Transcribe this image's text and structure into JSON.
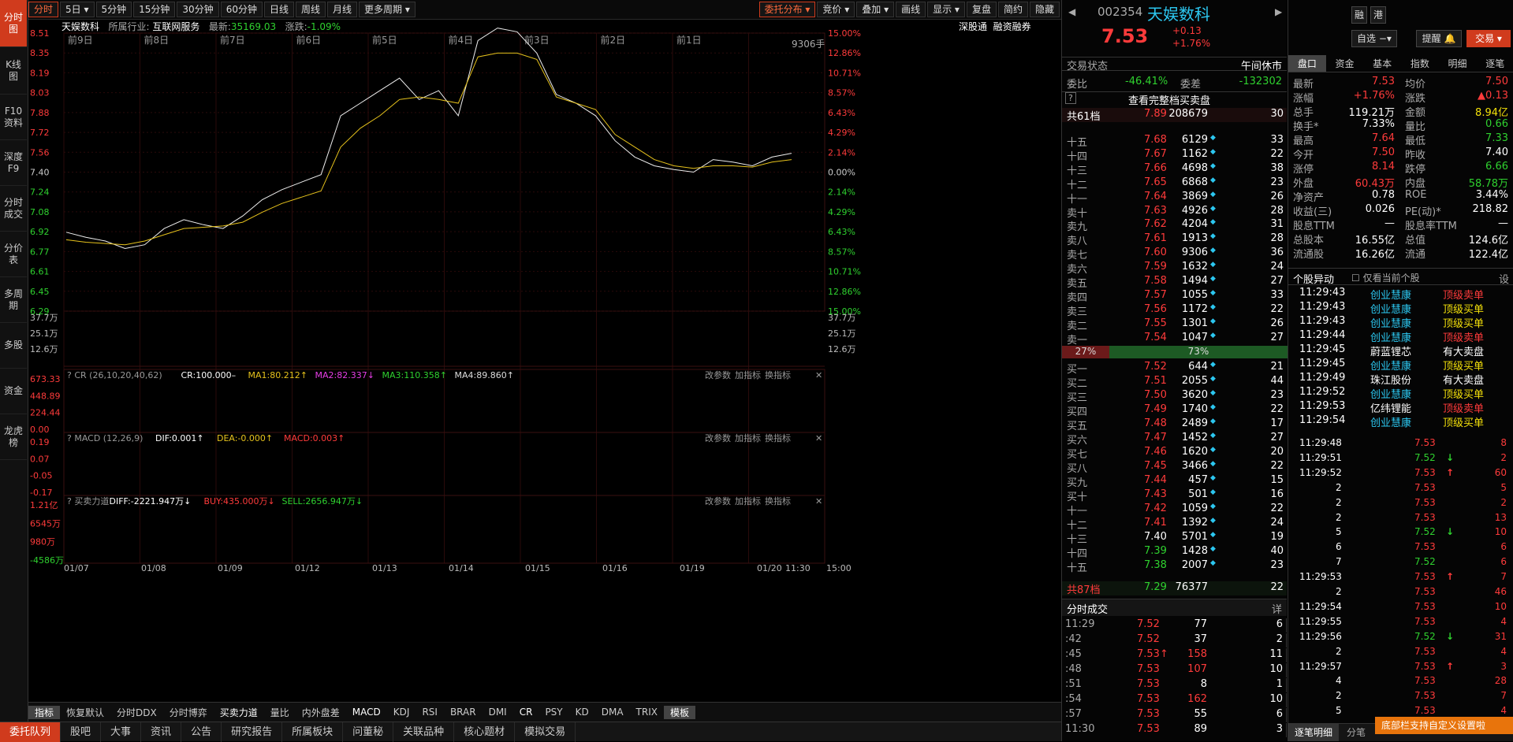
{
  "left_nav": [
    "分时图",
    "K线图",
    "F10资料",
    "深度F9",
    "分时成交",
    "分价表",
    "多周期",
    "多股",
    "资金",
    "龙虎榜"
  ],
  "toolbar": {
    "periods": [
      "分时",
      "5日",
      "5分钟",
      "15分钟",
      "30分钟",
      "60分钟",
      "日线",
      "周线",
      "月线",
      "更多周期"
    ],
    "tools": [
      "委托分布",
      "竞价",
      "叠加",
      "画线",
      "显示",
      "复盘",
      "简约",
      "隐藏"
    ]
  },
  "chart_info": {
    "name": "天娱数科",
    "industry_label": "所属行业:",
    "industry": "互联网服务",
    "latest_label": "最新:",
    "latest": "35169.03",
    "change_label": "涨跌:",
    "change": "-1.09%",
    "link1": "深股通",
    "link2": "融资融券",
    "volume_label": "9306手"
  },
  "chart_data": {
    "type": "line",
    "title": "天娱数科",
    "day_labels": [
      "前9日",
      "前8日",
      "前7日",
      "前6日",
      "前5日",
      "前4日",
      "前3日",
      "前2日",
      "前1日"
    ],
    "y_left": [
      "8.51",
      "8.35",
      "8.19",
      "8.03",
      "7.88",
      "7.72",
      "7.56",
      "7.40",
      "7.24",
      "7.08",
      "6.92",
      "6.77",
      "6.61",
      "6.45",
      "6.29"
    ],
    "y_right": [
      "15.00%",
      "12.86%",
      "10.71%",
      "8.57%",
      "6.43%",
      "4.29%",
      "2.14%",
      "0.00%",
      "2.14%",
      "4.29%",
      "6.43%",
      "8.57%",
      "10.71%",
      "12.86%",
      "15.00%"
    ],
    "ylim": [
      6.29,
      8.51
    ],
    "preclose": 7.4,
    "x_labels": [
      "01/07",
      "01/08",
      "01/09",
      "01/12",
      "01/13",
      "01/14",
      "01/15",
      "01/16",
      "01/19",
      "01/20",
      "11:30",
      "15:00"
    ],
    "series": [
      {
        "name": "price",
        "values": [
          6.92,
          6.88,
          6.85,
          6.79,
          6.82,
          6.95,
          7.02,
          6.98,
          6.95,
          7.05,
          7.18,
          7.26,
          7.32,
          7.38,
          7.85,
          7.95,
          8.05,
          8.15,
          7.98,
          8.05,
          7.85,
          8.45,
          8.55,
          8.52,
          8.35,
          8.02,
          7.95,
          7.85,
          7.65,
          7.52,
          7.45,
          7.42,
          7.4,
          7.5,
          7.48,
          7.45,
          7.52,
          7.55
        ]
      },
      {
        "name": "avg",
        "values": [
          6.86,
          6.84,
          6.83,
          6.82,
          6.85,
          6.9,
          6.95,
          6.96,
          6.97,
          7.0,
          7.08,
          7.15,
          7.2,
          7.25,
          7.6,
          7.75,
          7.85,
          7.98,
          8.0,
          7.98,
          7.95,
          8.32,
          8.35,
          8.35,
          8.3,
          8.0,
          7.95,
          7.9,
          7.7,
          7.6,
          7.5,
          7.45,
          7.43,
          7.45,
          7.45,
          7.44,
          7.48,
          7.5
        ]
      }
    ],
    "volume_axis": [
      "37.7万",
      "25.1万",
      "12.6万"
    ],
    "indicators": [
      {
        "name": "CR",
        "params": "(26,10,20,40,62)",
        "values": [
          "CR:100.000–",
          "MA1:80.212↑",
          "MA2:82.337↓",
          "MA3:110.358↑",
          "MA4:89.860↑"
        ],
        "axis": [
          "673.33",
          "448.89",
          "224.44",
          "0.00"
        ]
      },
      {
        "name": "MACD",
        "params": "(12,26,9)",
        "values": [
          "DIF:0.001↑",
          "DEA:-0.000↑",
          "MACD:0.003↑"
        ],
        "axis": [
          "0.19",
          "0.07",
          "-0.05",
          "-0.17"
        ]
      },
      {
        "name": "买卖力道",
        "params": "",
        "values": [
          "DIFF:-2221.947万↓",
          "BUY:435.000万↓",
          "SELL:2656.947万↓"
        ],
        "axis": [
          "1.21亿",
          "6545万",
          "980万",
          "-4586万"
        ]
      }
    ],
    "indicator_actions": [
      "改参数",
      "加指标",
      "换指标"
    ]
  },
  "bottom_bar": [
    "指标",
    "恢复默认",
    "分时DDX",
    "分时博弈",
    "买卖力道",
    "量比",
    "内外盘差",
    "MACD",
    "KDJ",
    "RSI",
    "BRAR",
    "DMI",
    "CR",
    "PSY",
    "KD",
    "DMA",
    "TRIX",
    "模板"
  ],
  "bottom_tabs": [
    "委托队列",
    "股吧",
    "大事",
    "资讯",
    "公告",
    "研究报告",
    "所属板块",
    "问董秘",
    "关联品种",
    "核心题材",
    "模拟交易"
  ],
  "quote": {
    "code": "002354",
    "name": "天娱数科",
    "price": "7.53",
    "chg": "+0.13",
    "pct": "+1.76%",
    "status_label": "交易状态",
    "status": "午间休市",
    "wb_label": "委比",
    "wb": "-46.41%",
    "wc_label": "委差",
    "wc": "-132302",
    "full_link": "查看完整档买卖盘",
    "sell_total": {
      "label": "共61档",
      "price": "7.89",
      "vol": "208679",
      "n": "30"
    },
    "buy_total": {
      "label": "共87档",
      "price": "7.29",
      "vol": "76377",
      "n": "22"
    },
    "sells": [
      [
        "十五",
        "7.68",
        "6129",
        "33"
      ],
      [
        "十四",
        "7.67",
        "1162",
        "22"
      ],
      [
        "十三",
        "7.66",
        "4698",
        "38"
      ],
      [
        "十二",
        "7.65",
        "6868",
        "23"
      ],
      [
        "十一",
        "7.64",
        "3869",
        "26"
      ],
      [
        "卖十",
        "7.63",
        "4926",
        "28"
      ],
      [
        "卖九",
        "7.62",
        "4204",
        "31"
      ],
      [
        "卖八",
        "7.61",
        "1913",
        "28"
      ],
      [
        "卖七",
        "7.60",
        "9306",
        "36"
      ],
      [
        "卖六",
        "7.59",
        "1632",
        "24"
      ],
      [
        "卖五",
        "7.58",
        "1494",
        "27"
      ],
      [
        "卖四",
        "7.57",
        "1055",
        "33"
      ],
      [
        "卖三",
        "7.56",
        "1172",
        "22"
      ],
      [
        "卖二",
        "7.55",
        "1301",
        "26"
      ],
      [
        "卖一",
        "7.54",
        "1047",
        "27"
      ]
    ],
    "ratio": [
      "27%",
      "73%"
    ],
    "buys": [
      [
        "买一",
        "7.52",
        "644",
        "21"
      ],
      [
        "买二",
        "7.51",
        "2055",
        "44"
      ],
      [
        "买三",
        "7.50",
        "3620",
        "23"
      ],
      [
        "买四",
        "7.49",
        "1740",
        "22"
      ],
      [
        "买五",
        "7.48",
        "2489",
        "17"
      ],
      [
        "买六",
        "7.47",
        "1452",
        "27"
      ],
      [
        "买七",
        "7.46",
        "1620",
        "20"
      ],
      [
        "买八",
        "7.45",
        "3466",
        "22"
      ],
      [
        "买九",
        "7.44",
        "457",
        "15"
      ],
      [
        "买十",
        "7.43",
        "501",
        "16"
      ],
      [
        "十一",
        "7.42",
        "1059",
        "22"
      ],
      [
        "十二",
        "7.41",
        "1392",
        "24"
      ],
      [
        "十三",
        "7.40",
        "5701",
        "19"
      ],
      [
        "十四",
        "7.39",
        "1428",
        "40"
      ],
      [
        "十五",
        "7.38",
        "2007",
        "23"
      ]
    ],
    "ticks_title": "分时成交",
    "ticks_detail": "详",
    "ticks": [
      [
        "11:29",
        "7.52",
        "77",
        "6"
      ],
      [
        ":42",
        "7.52",
        "37",
        "2"
      ],
      [
        ":45",
        "7.53↑",
        "158",
        "11"
      ],
      [
        ":48",
        "7.53",
        "107",
        "10"
      ],
      [
        ":51",
        "7.53",
        "8",
        "1"
      ],
      [
        ":54",
        "7.53",
        "162",
        "10"
      ],
      [
        ":57",
        "7.53",
        "55",
        "6"
      ],
      [
        "11:30",
        "7.53",
        "89",
        "3"
      ]
    ]
  },
  "far_right": {
    "tags": [
      "融",
      "港"
    ],
    "buttons": [
      "自选",
      "提醒",
      "交易"
    ],
    "tabs": [
      "盘口",
      "资金",
      "基本",
      "指数",
      "明细",
      "逐笔"
    ],
    "stats": [
      [
        "最新",
        "7.53",
        "均价",
        "7.50"
      ],
      [
        "涨幅",
        "+1.76%",
        "涨跌",
        "▲0.13"
      ],
      [
        "总手",
        "119.21万",
        "金额",
        "8.94亿"
      ],
      [
        "换手*",
        "7.33%",
        "量比",
        "0.66"
      ],
      [
        "最高",
        "7.64",
        "最低",
        "7.33"
      ],
      [
        "今开",
        "7.50",
        "昨收",
        "7.40"
      ],
      [
        "涨停",
        "8.14",
        "跌停",
        "6.66"
      ],
      [
        "外盘",
        "60.43万",
        "内盘",
        "58.78万"
      ],
      [
        "净资产",
        "0.78",
        "ROE",
        "3.44%"
      ],
      [
        "收益(三)",
        "0.026",
        "PE(动)*",
        "218.82"
      ],
      [
        "股息TTM",
        "—",
        "股息率TTM",
        "—"
      ],
      [
        "总股本",
        "16.55亿",
        "总值",
        "124.6亿"
      ],
      [
        "流通股",
        "16.26亿",
        "流通",
        "122.4亿"
      ]
    ],
    "movers_title": "个股异动",
    "movers_opt": "仅看当前个股",
    "movers_set": "设",
    "movers": [
      [
        "11:29:43",
        "创业慧康",
        "顶级卖单"
      ],
      [
        "11:29:43",
        "创业慧康",
        "顶级买单"
      ],
      [
        "11:29:43",
        "创业慧康",
        "顶级买单"
      ],
      [
        "11:29:44",
        "创业慧康",
        "顶级卖单"
      ],
      [
        "11:29:45",
        "蔚蓝锂芯",
        "有大卖盘"
      ],
      [
        "11:29:45",
        "创业慧康",
        "顶级买单"
      ],
      [
        "11:29:49",
        "珠江股份",
        "有大卖盘"
      ],
      [
        "11:29:52",
        "创业慧康",
        "顶级买单"
      ],
      [
        "11:29:53",
        "亿纬锂能",
        "顶级卖单"
      ],
      [
        "11:29:54",
        "创业慧康",
        "顶级买单"
      ]
    ],
    "trades": [
      [
        "11:29:48",
        "7.53",
        "",
        "8"
      ],
      [
        "11:29:51",
        "7.52",
        "↓",
        "2"
      ],
      [
        "11:29:52",
        "7.53",
        "↑",
        "60"
      ],
      [
        "2",
        "7.53",
        "",
        "5"
      ],
      [
        "2",
        "7.53",
        "",
        "2"
      ],
      [
        "2",
        "7.53",
        "",
        "13"
      ],
      [
        "5",
        "7.52",
        "↓",
        "10"
      ],
      [
        "6",
        "7.53",
        "",
        "6"
      ],
      [
        "7",
        "7.52",
        "",
        "6"
      ],
      [
        "11:29:53",
        "7.53",
        "↑",
        "7"
      ],
      [
        "2",
        "7.53",
        "",
        "46"
      ],
      [
        "11:29:54",
        "7.53",
        "",
        "10"
      ],
      [
        "11:29:55",
        "7.53",
        "",
        "4"
      ],
      [
        "11:29:56",
        "7.52",
        "↓",
        "31"
      ],
      [
        "2",
        "7.53",
        "",
        "4"
      ],
      [
        "11:29:57",
        "7.53",
        "↑",
        "3"
      ],
      [
        "4",
        "7.53",
        "",
        "28"
      ],
      [
        "2",
        "7.53",
        "",
        "7"
      ],
      [
        "5",
        "7.53",
        "",
        "4"
      ]
    ],
    "bottom_tabs": [
      "逐笔明细",
      "分笔"
    ],
    "toast": "底部栏支持自定义设置啦"
  }
}
